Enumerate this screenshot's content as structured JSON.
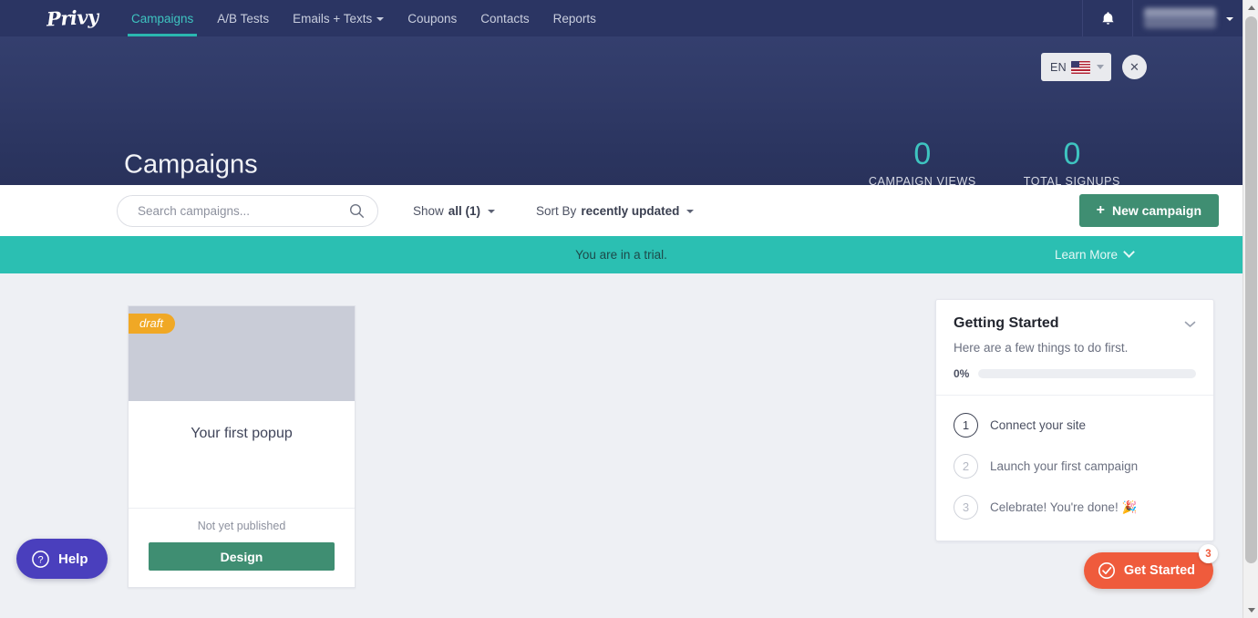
{
  "navbar": {
    "logo": "Privy",
    "items": [
      {
        "label": "Campaigns",
        "active": true,
        "dropdown": false
      },
      {
        "label": "A/B Tests",
        "active": false,
        "dropdown": false
      },
      {
        "label": "Emails + Texts",
        "active": false,
        "dropdown": true
      },
      {
        "label": "Coupons",
        "active": false,
        "dropdown": false
      },
      {
        "label": "Contacts",
        "active": false,
        "dropdown": false
      },
      {
        "label": "Reports",
        "active": false,
        "dropdown": false
      }
    ],
    "bell_icon": "bell-icon",
    "account_name": ""
  },
  "hero": {
    "title": "Campaigns",
    "language": {
      "label": "EN",
      "flag": "us-flag-icon"
    },
    "close_label": "✕",
    "stats": [
      {
        "value": "0",
        "label": "CAMPAIGN VIEWS"
      },
      {
        "value": "0",
        "label": "TOTAL SIGNUPS"
      }
    ]
  },
  "toolbar": {
    "search_placeholder": "Search campaigns...",
    "search_value": "",
    "search_icon": "search-icon",
    "show_prefix": "Show",
    "show_value": "all (1)",
    "sort_prefix": "Sort By",
    "sort_value": "recently updated",
    "new_campaign_label": "New campaign",
    "new_campaign_plus": "+"
  },
  "trial_banner": {
    "text": "You are in a trial.",
    "learn_more": "Learn More"
  },
  "campaign_card": {
    "badge": "draft",
    "name": "Your first popup",
    "status": "Not yet published",
    "action_label": "Design"
  },
  "getting_started": {
    "title": "Getting Started",
    "subtitle": "Here are a few things to do first.",
    "progress_pct": "0%",
    "progress_value": 0,
    "collapse_icon": "chevron-down-icon",
    "steps": [
      {
        "num": "1",
        "label": "Connect your site",
        "active": true
      },
      {
        "num": "2",
        "label": "Launch your first campaign",
        "active": false
      },
      {
        "num": "3",
        "label": "Celebrate! You're done! 🎉",
        "active": false
      }
    ]
  },
  "help_widget": {
    "label": "Help",
    "icon": "question-circle-icon"
  },
  "get_started_widget": {
    "label": "Get Started",
    "badge": "3",
    "icon": "check-circle-icon"
  },
  "colors": {
    "navy": "#2b3563",
    "teal": "#2bbfb2",
    "green": "#3f8e72",
    "orange": "#f0a825",
    "coral": "#ef5b3c",
    "purple": "#4a3fbd"
  }
}
